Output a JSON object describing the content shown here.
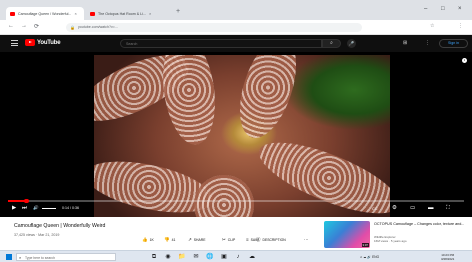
{
  "browser": {
    "tabs": [
      {
        "title": "Camouflage Queen / Wonderful...",
        "close": "×"
      },
      {
        "title": "The Octopus Hat Room & Li...",
        "close": "×"
      }
    ],
    "new_tab": "+",
    "window_controls": {
      "minimize": "–",
      "maximize": "□",
      "close": "×"
    },
    "nav": {
      "back": "←",
      "forward": "→",
      "reload": "⟳"
    },
    "address": "youtube.com/watch?v=...",
    "lock": "🔒",
    "toolbar_icons": {
      "star": "☆",
      "extensions": "⋮"
    }
  },
  "youtube_header": {
    "logo_text": "YouTube",
    "search_placeholder": "Search",
    "search_icon": "⌕",
    "mic_icon": "🎤",
    "create_icon": "⊞",
    "more_icon": "⋮",
    "sign_in_label": "Sign in"
  },
  "player": {
    "time": "0:14 / 0:36",
    "controls": {
      "play": "▶",
      "next": "⏭",
      "volume": "🔊",
      "captions": "CC",
      "settings": "⚙",
      "miniplayer": "▭",
      "theater": "▬",
      "fullscreen": "⛶"
    },
    "progress": 0.04,
    "info": "i"
  },
  "video": {
    "title": "Camouflage Queen | Wonderfully Weird",
    "meta": "37,425 views · Mar 21, 2019",
    "actions": [
      {
        "icon": "👍",
        "label": "1K"
      },
      {
        "icon": "👎",
        "label": "41"
      },
      {
        "icon": "↗",
        "label": "SHARE"
      },
      {
        "icon": "✂",
        "label": "CLIP"
      },
      {
        "icon": "≡",
        "label": "SAVE"
      },
      {
        "icon": "ⓘ",
        "label": "DESCRIPTION"
      },
      {
        "icon": "⋯",
        "label": ""
      }
    ]
  },
  "recommendation": {
    "title": "OCTOPUS Camouflage – Changes color, texture and...",
    "channel": "Wildlife Explorer",
    "views": "16M views · 5 years ago",
    "duration": "3:07"
  },
  "taskbar": {
    "search_placeholder": "Type here to search",
    "search_icon": "⌕",
    "apps": [
      "⧉",
      "◉",
      "📁",
      "✉",
      "🌐",
      "▣",
      "♪",
      "☁"
    ],
    "tray": "∧  ☁  🔊  ENG",
    "time": "10:23 PM",
    "date": "3/28/2021"
  }
}
